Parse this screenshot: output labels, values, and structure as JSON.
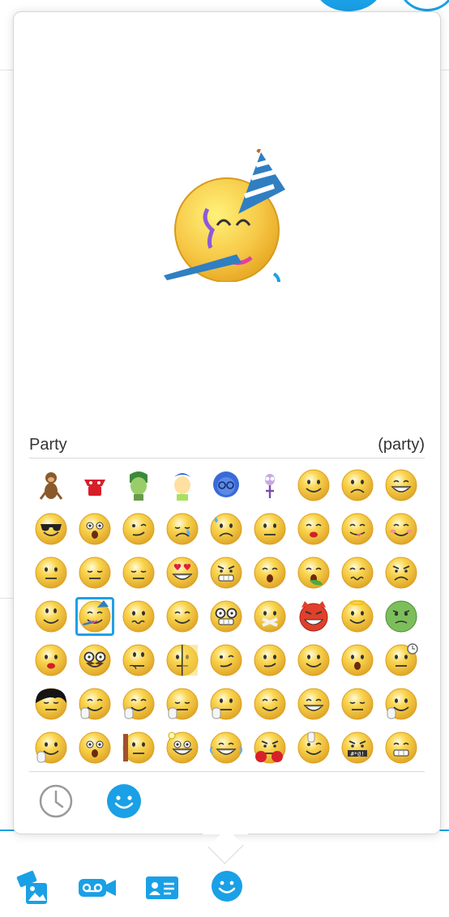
{
  "preview": {
    "name": "Party",
    "shortcut": "(party)"
  },
  "emoticons": [
    [
      "monkey",
      "red-mask",
      "disgust",
      "joy",
      "sadness",
      "fear",
      "smile",
      "sad",
      "laugh"
    ],
    [
      "cool",
      "surprised",
      "wink",
      "crying",
      "sweating",
      "speechless",
      "kiss",
      "tongue-out",
      "blush"
    ],
    [
      "wondering",
      "sleepy",
      "dull",
      "inlove",
      "evil-grin",
      "yawn",
      "puke",
      "doh",
      "angry"
    ],
    [
      "wasntme",
      "party",
      "worried",
      "mmm",
      "nerd",
      "lips-sealed",
      "devil",
      "angel",
      "envy"
    ],
    [
      "make-up",
      "mustache",
      "thinking",
      "hidden",
      "smirk",
      "half-smile",
      "happy",
      "talking",
      "waiting"
    ],
    [
      "emo",
      "finger-crossed",
      "hi",
      "facepalm",
      "shh",
      "giggle",
      "rofl",
      "headbang",
      "wave"
    ],
    [
      "hands-up",
      "call",
      "wall",
      "idea",
      "laugh-tears",
      "boxing",
      "rock",
      "swear",
      "grin"
    ]
  ],
  "selected": "party",
  "tabs": [
    {
      "id": "recent",
      "icon": "clock-icon",
      "active": false
    },
    {
      "id": "emoticons",
      "icon": "smiley-icon",
      "active": true
    }
  ],
  "toolbar": [
    {
      "id": "media",
      "icon": "send-media-icon"
    },
    {
      "id": "video-message",
      "icon": "video-message-icon"
    },
    {
      "id": "contact",
      "icon": "contact-card-icon"
    },
    {
      "id": "emoticons",
      "icon": "emoticon-icon"
    }
  ],
  "colors": {
    "accent": "#1aa0e6",
    "face": "#f7c948",
    "face-edge": "#d99a1c"
  }
}
